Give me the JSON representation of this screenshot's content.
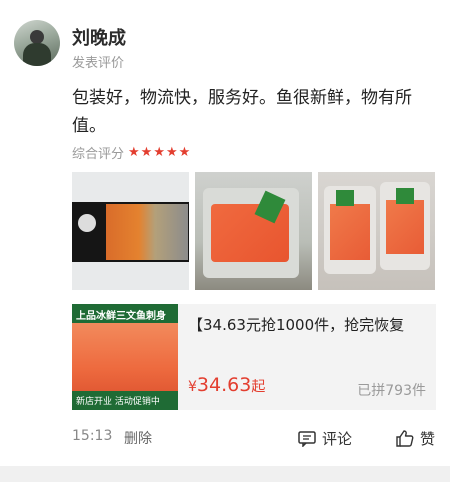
{
  "user": {
    "name": "刘晚成",
    "subtitle": "发表评价"
  },
  "review": {
    "text": "包装好，物流快，服务好。鱼很新鲜，物有所值。",
    "rating_label": "综合评分",
    "rating": 5,
    "stars": "★★★★★"
  },
  "photos": [
    "photo-1",
    "photo-2",
    "photo-3"
  ],
  "product": {
    "thumb_top": "上品冰鲜三文鱼刺身",
    "thumb_bottom": "新店开业 活动促销中",
    "title": "【34.63元抢1000件，抢完恢复",
    "price_symbol": "¥",
    "price": "34.63",
    "price_suffix": "起",
    "sold": "已拼793件"
  },
  "footer": {
    "time": "15:13",
    "delete": "删除",
    "comment": "评论",
    "like": "赞"
  },
  "colors": {
    "accent": "#e33e2f",
    "muted": "#9a9a9a"
  },
  "icons": {
    "comment": "comment-icon",
    "like": "thumbs-up-icon"
  }
}
